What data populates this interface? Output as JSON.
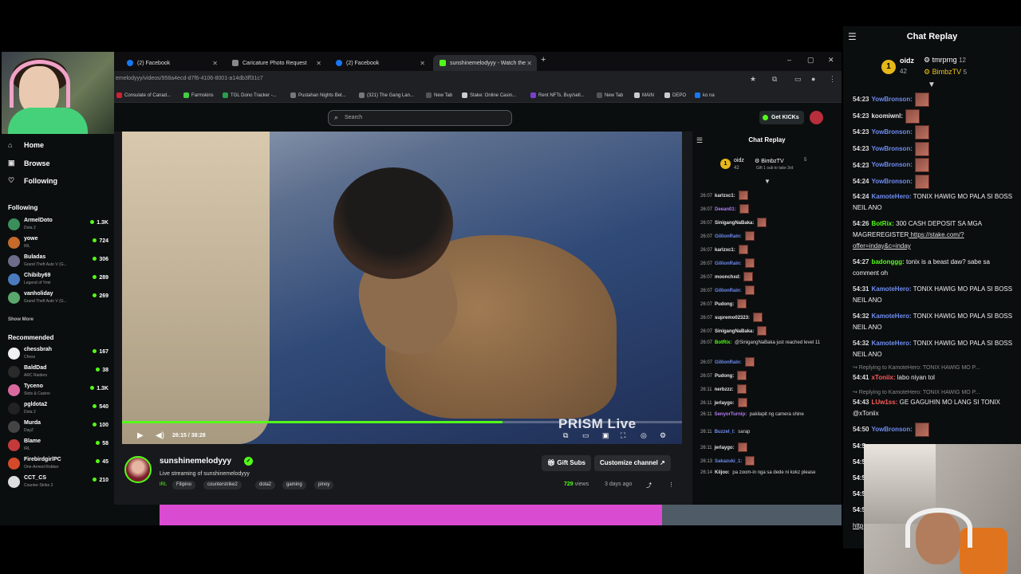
{
  "browser": {
    "tabs": [
      {
        "label": "(2) Facebook",
        "color": "#1877f2"
      },
      {
        "label": "Caricature Photo Request",
        "color": "#888888"
      },
      {
        "label": "(2) Facebook",
        "color": "#1877f2"
      },
      {
        "label": "sunshinemelodyyy - Watch the",
        "color": "#53fc18"
      }
    ],
    "url": "emelodyyy/videos/958a4ecd-d7f6-4106-8001-a14db3ff31c7",
    "bookmarks": [
      "Consulate of Canad...",
      "Farmskins",
      "TGL Dono Tracker -...",
      "Pustahan Nights Bet...",
      "(321) The Gang Lan...",
      "New Tab",
      "Stake: Online Casin...",
      "Rent NFTs. Buy/sell...",
      "New Tab",
      "MAIN",
      "DEPO",
      "ko na"
    ]
  },
  "kick": {
    "search_placeholder": "Search",
    "get_kicks": "Get KICKs"
  },
  "sidebar": {
    "nav": [
      "Home",
      "Browse",
      "Following"
    ],
    "following_title": "Following",
    "following": [
      {
        "name": "ArmelDoto",
        "game": "Dota 2",
        "viewers": "1.3K",
        "color": "#3b8f5a"
      },
      {
        "name": "yowe",
        "game": "IRL",
        "viewers": "724",
        "color": "#c46b2b"
      },
      {
        "name": "Buladas",
        "game": "Grand Theft Auto V (G...",
        "viewers": "306",
        "color": "#6d6d8a"
      },
      {
        "name": "Chibiby69",
        "game": "Legend of Ymir",
        "viewers": "289",
        "color": "#4b7bbf"
      },
      {
        "name": "vanholiday",
        "game": "Grand Theft Auto V (G...",
        "viewers": "269",
        "color": "#5aa86b"
      }
    ],
    "show_more": "Show More",
    "recommended_title": "Recommended",
    "recommended": [
      {
        "name": "chessbrah",
        "game": "Chess",
        "viewers": "167",
        "color": "#f0f0f0"
      },
      {
        "name": "BaldDad",
        "game": "ARC Raiders",
        "viewers": "38",
        "color": "#2a2a2a"
      },
      {
        "name": "Tyceno",
        "game": "Slots & Casino",
        "viewers": "1.3K",
        "color": "#d96aa0"
      },
      {
        "name": "pgldota2",
        "game": "Dota 2",
        "viewers": "540",
        "color": "#222"
      },
      {
        "name": "Murda",
        "game": "DayZ",
        "viewers": "100",
        "color": "#444"
      },
      {
        "name": "Blame",
        "game": "IRL",
        "viewers": "58",
        "color": "#c43a3a"
      },
      {
        "name": "FirebirdgirlPC",
        "game": "One-Armed Robber",
        "viewers": "45",
        "color": "#d44a2a"
      },
      {
        "name": "CCT_CS",
        "game": "Counter-Strike 2",
        "viewers": "210",
        "color": "#ddd"
      }
    ]
  },
  "video": {
    "time": "26:15 / 38:28",
    "progress": 0.68,
    "watermark": "PRISM Live"
  },
  "channel": {
    "name": "sunshinemelodyyy",
    "stream_title": "Live streaming of sunshinemelodyyy",
    "category": "IRL",
    "tags": [
      "Filipino",
      "counterstrike2",
      "dota2",
      "gaming",
      "pinoy"
    ],
    "gift_subs": "Gift Subs",
    "customize": "Customize channel",
    "views": "729",
    "views_label": "views",
    "ago": "3 days ago"
  },
  "inner_chat": {
    "title": "Chat Replay",
    "pinned": {
      "user1": "oidz",
      "user1_count": "42",
      "user2": "BimbzTV",
      "user2_count": "5",
      "note": "Gift 1 sub to take 3rd"
    },
    "messages": [
      {
        "t": "26:07",
        "u": "karlzxc1:",
        "c": "#e6e6e6",
        "text": ""
      },
      {
        "t": "26:07",
        "u": "Deean01:",
        "c": "#b07cf0",
        "text": ""
      },
      {
        "t": "26:07",
        "u": "SinigangNaBaka:",
        "c": "#e6e6e6",
        "text": ""
      },
      {
        "t": "26:07",
        "u": "GillionRain:",
        "c": "#6f8cf0",
        "text": ""
      },
      {
        "t": "26:07",
        "u": "karlzxc1:",
        "c": "#e6e6e6",
        "text": ""
      },
      {
        "t": "26:07",
        "u": "GillionRain:",
        "c": "#6f8cf0",
        "text": ""
      },
      {
        "t": "26:07",
        "u": "moonchxd:",
        "c": "#e6e6e6",
        "text": ""
      },
      {
        "t": "26:07",
        "u": "GillionRain:",
        "c": "#6f8cf0",
        "text": ""
      },
      {
        "t": "26:07",
        "u": "Pudong:",
        "c": "#e6e6e6",
        "text": ""
      },
      {
        "t": "26:07",
        "u": "supremo02323:",
        "c": "#e6e6e6",
        "text": ""
      },
      {
        "t": "26:07",
        "u": "SinigangNaBaka:",
        "c": "#e6e6e6",
        "text": ""
      },
      {
        "t": "26:07",
        "u": "BotRix:",
        "c": "#53fc18",
        "text": "@SinigangNaBaka just reached level 11"
      },
      {
        "t": "26:07",
        "u": "GillionRain:",
        "c": "#6f8cf0",
        "text": ""
      },
      {
        "t": "26:07",
        "u": "Pudong:",
        "c": "#e6e6e6",
        "text": ""
      },
      {
        "t": "26:11",
        "u": "nerbzzz:",
        "c": "#e6e6e6",
        "text": ""
      },
      {
        "t": "26:11",
        "u": "jerlaygo:",
        "c": "#e6e6e6",
        "text": ""
      },
      {
        "t": "26:11",
        "u": "SenyorTurnip:",
        "c": "#b07cf0",
        "text": "pakilapit ng camera shine"
      },
      {
        "t": "26:11",
        "u": "Buzzel_l:",
        "c": "#6f8cf0",
        "text": "sarap"
      },
      {
        "t": "26:11",
        "u": "jerlaygo:",
        "c": "#e6e6e6",
        "text": ""
      },
      {
        "t": "26:13",
        "u": "Sakazuki_1:",
        "c": "#6f8cf0",
        "text": ""
      },
      {
        "t": "26:14",
        "u": "Kiijoo:",
        "c": "#e6e6e6",
        "text": "pa zoom-in nga sa dede ni kokz please"
      }
    ]
  },
  "right_chat": {
    "title": "Chat Replay",
    "pinned": {
      "user1": "oidz",
      "user1_count": "42",
      "user2": "tmrprng",
      "user2_count": "12",
      "user3": "BimbzTV",
      "user3_count": "5"
    },
    "messages": [
      {
        "t": "54:23",
        "u": "YowBronson:",
        "c": "#6f8cf0",
        "text": "",
        "emote": true
      },
      {
        "t": "54:23",
        "u": "koomiwnl:",
        "c": "#e6e6e6",
        "text": "",
        "emote": true
      },
      {
        "t": "54:23",
        "u": "YowBronson:",
        "c": "#6f8cf0",
        "text": "",
        "emote": true
      },
      {
        "t": "54:23",
        "u": "YowBronson:",
        "c": "#6f8cf0",
        "text": "",
        "emote": true
      },
      {
        "t": "54:23",
        "u": "YowBronson:",
        "c": "#6f8cf0",
        "text": "",
        "emote": true
      },
      {
        "t": "54:24",
        "u": "YowBronson:",
        "c": "#6f8cf0",
        "text": "",
        "emote": true
      },
      {
        "t": "54:24",
        "u": "KamoteHero:",
        "c": "#6f8cf0",
        "text": "TONIX HAWIG MO PALA SI BOSS NEIL ANO"
      },
      {
        "t": "54:26",
        "u": "BotRix:",
        "c": "#53fc18",
        "text": "300 CASH DEPOSIT SA MGA MAGREREGISTER",
        "link": "https://stake.com/?offer=inday&c=inday"
      },
      {
        "t": "54:27",
        "u": "badonggg:",
        "c": "#53fc18",
        "text": "tonix is a beast daw? sabe sa comment oh"
      },
      {
        "t": "54:31",
        "u": "KamoteHero:",
        "c": "#6f8cf0",
        "text": "TONIX HAWIG MO PALA SI BOSS NEIL ANO"
      },
      {
        "t": "54:32",
        "u": "KamoteHero:",
        "c": "#6f8cf0",
        "text": "TONIX HAWIG MO PALA SI BOSS NEIL ANO"
      },
      {
        "t": "54:32",
        "u": "KamoteHero:",
        "c": "#6f8cf0",
        "text": "TONIX HAWIG MO PALA SI BOSS NEIL ANO"
      }
    ],
    "reply1": "Replying to KamoteHero: TONIX HAWIG MO P...",
    "reply1_msg": {
      "t": "54:41",
      "u": "xToniix:",
      "text": "labo niyan tol"
    },
    "reply2": "Replying to KamoteHero: TONIX HAWIG MO P...",
    "reply2_msg": {
      "t": "54:43",
      "u": "LUw1ss:",
      "text": "GE GAGUHIN MO LANG SI TONIX @xToniix"
    },
    "last_msg": {
      "t": "54:50",
      "u": "YowBronson:"
    },
    "partial_times": [
      "54:5",
      "54:5",
      "54:5",
      "54:5",
      "54:5"
    ],
    "partial_link": "http"
  }
}
